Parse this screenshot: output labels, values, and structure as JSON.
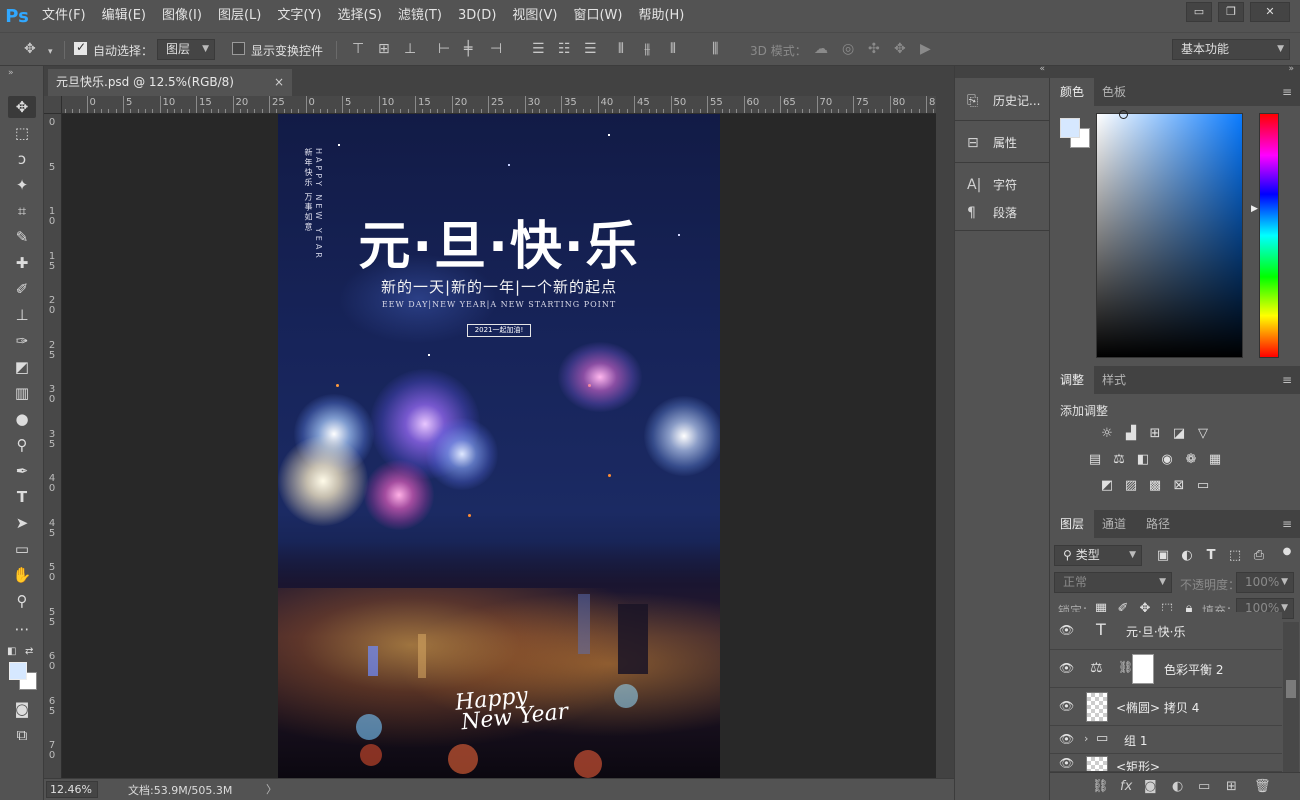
{
  "app": {
    "logo": "Ps"
  },
  "menu": [
    "文件(F)",
    "编辑(E)",
    "图像(I)",
    "图层(L)",
    "文字(Y)",
    "选择(S)",
    "滤镜(T)",
    "3D(D)",
    "视图(V)",
    "窗口(W)",
    "帮助(H)"
  ],
  "window_controls": {
    "minimize": "▭",
    "restore": "❐",
    "close": "✕"
  },
  "options": {
    "auto_select_label": "自动选择：",
    "auto_select_target": "图层",
    "show_transform_label": "显示变换控件",
    "mode3d_label": "3D 模式：",
    "workspace": "基本功能"
  },
  "document": {
    "tab_title": "元旦快乐.psd @ 12.5%(RGB/8)",
    "close": "×"
  },
  "ruler_top_labels": [
    "5",
    "0",
    "5",
    "10",
    "15",
    "20",
    "25",
    "0",
    "5",
    "10",
    "15",
    "20",
    "25",
    "30",
    "35",
    "40",
    "45",
    "50",
    "55",
    "60",
    "65",
    "70",
    "75",
    "80",
    "85"
  ],
  "ruler_left_labels": [
    "0",
    "5",
    "1\n0",
    "1\n5",
    "2\n0",
    "2\n5",
    "3\n0",
    "3\n5",
    "4\n0",
    "4\n5",
    "5\n0",
    "5\n5",
    "6\n0",
    "6\n5",
    "7\n0"
  ],
  "poster": {
    "vertical_cn": "新年快乐 万事如意",
    "vertical_en": "HAPPY NEW YEAR",
    "title": "元·旦·快·乐",
    "subtitle": "新的一天|新的一年|一个新的起点",
    "subtitle_en": "EEW DAY|NEW YEAR|A NEW STARTING POINT",
    "badge": "2021一起加油!",
    "happy_line1": "Happy",
    "happy_line2": "New Year"
  },
  "mid_panel": [
    {
      "label": "历史记...",
      "icon": "history-icon"
    },
    {
      "label": "属性",
      "icon": "properties-icon"
    },
    {
      "label": "字符",
      "icon": "character-icon"
    },
    {
      "label": "段落",
      "icon": "paragraph-icon"
    }
  ],
  "color_panel": {
    "tabs": [
      "颜色",
      "色板"
    ],
    "foreground": "#d6e8ff",
    "background": "#ffffff"
  },
  "adjust_panel": {
    "tabs": [
      "调整",
      "样式"
    ],
    "add_label": "添加调整"
  },
  "layers_panel": {
    "tabs": [
      "图层",
      "通道",
      "路径"
    ],
    "filter_kind": "类型",
    "blend_mode": "正常",
    "opacity_label": "不透明度：",
    "opacity_value": "100%",
    "lock_label": "锁定：",
    "fill_label": "填充：",
    "fill_value": "100%",
    "layers": [
      {
        "name": "元·旦·快·乐",
        "type": "text"
      },
      {
        "name": "色彩平衡 2",
        "type": "adjustment"
      },
      {
        "name": "<椭圆> 拷贝 4",
        "type": "shape"
      },
      {
        "name": "组 1",
        "type": "group"
      },
      {
        "name": "<矩形>",
        "type": "shape"
      }
    ]
  },
  "status": {
    "zoom": "12.46%",
    "doc_info": "文档:53.9M/505.3M",
    "arrow": "〉"
  }
}
